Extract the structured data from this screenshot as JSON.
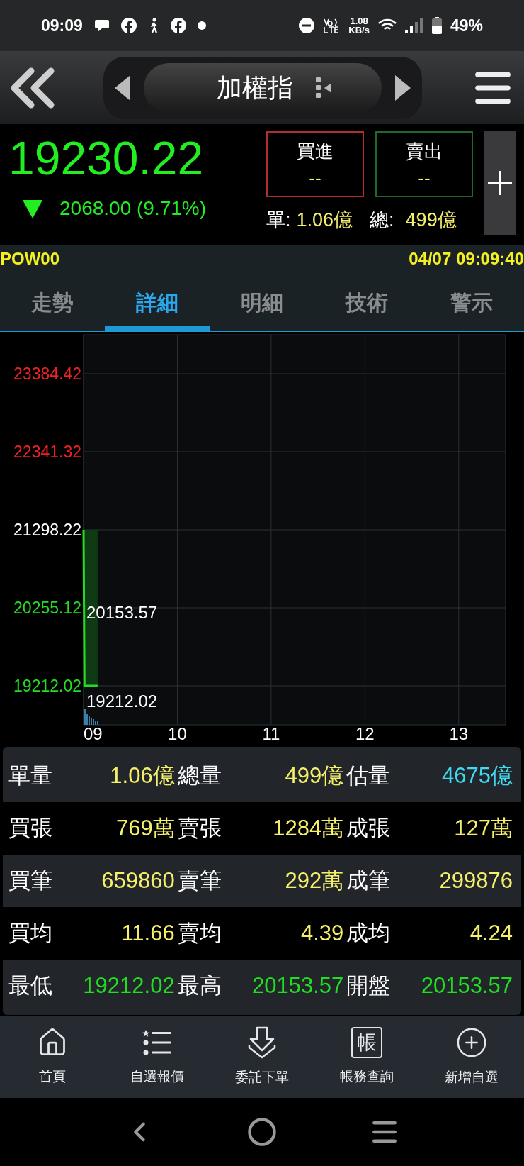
{
  "status_bar": {
    "time": "09:09",
    "speed_value": "1.08",
    "speed_unit": "KB/s",
    "battery": "49%"
  },
  "header": {
    "title": "加權指"
  },
  "quote": {
    "price": "19230.22",
    "change": "2068.00 (9.71%)",
    "buy": {
      "label": "買進",
      "value": "--"
    },
    "sell": {
      "label": "賣出",
      "value": "--"
    },
    "single_label": "單:",
    "single_value": "1.06億",
    "total_label": "總:",
    "total_value": "499億"
  },
  "info_bar": {
    "code": "POW00",
    "datetime": "04/07 09:09:40"
  },
  "tabs": [
    {
      "label": "走勢",
      "selected": false
    },
    {
      "label": "詳細",
      "selected": true
    },
    {
      "label": "明細",
      "selected": false
    },
    {
      "label": "技術",
      "selected": false
    },
    {
      "label": "警示",
      "selected": false
    }
  ],
  "chart_data": {
    "type": "line",
    "grid": true,
    "xlim": [
      9,
      13.5
    ],
    "ylim": [
      18690.47,
      23905.97
    ],
    "xticks": [
      {
        "value": 9,
        "label": "09"
      },
      {
        "value": 10,
        "label": "10"
      },
      {
        "value": 11,
        "label": "11"
      },
      {
        "value": 12,
        "label": "12"
      },
      {
        "value": 13,
        "label": "13"
      }
    ],
    "yticks": [
      {
        "value": 23384.42,
        "label": "23384.42"
      },
      {
        "value": 22341.32,
        "label": "22341.32"
      },
      {
        "value": 21298.22,
        "label": "21298.22"
      },
      {
        "value": 20255.12,
        "label": "20255.12"
      },
      {
        "value": 19212.02,
        "label": "19212.02"
      }
    ],
    "x": [
      9,
      9.01,
      9.15
    ],
    "series": [
      {
        "color": "#22dd22",
        "values": [
          21298.22,
          19212.02,
          19212.02
        ]
      }
    ]
  },
  "chart_labels": [
    {
      "kind": "high",
      "text": "20153.57"
    },
    {
      "kind": "low",
      "text": "19212.02"
    }
  ],
  "stats": [
    [
      {
        "label": "單量",
        "value": "1.06億",
        "color": "#f5f06a"
      },
      {
        "label": "總量",
        "value": "499億",
        "color": "#f5f06a"
      },
      {
        "label": "估量",
        "value": "4675億",
        "color": "#3fd9f0"
      }
    ],
    [
      {
        "label": "買張",
        "value": "769萬",
        "color": "#f5f06a"
      },
      {
        "label": "賣張",
        "value": "1284萬",
        "color": "#f5f06a"
      },
      {
        "label": "成張",
        "value": "127萬",
        "color": "#f5f06a"
      }
    ],
    [
      {
        "label": "買筆",
        "value": "659860",
        "color": "#f5f06a"
      },
      {
        "label": "賣筆",
        "value": "292萬",
        "color": "#f5f06a"
      },
      {
        "label": "成筆",
        "value": "299876",
        "color": "#f5f06a"
      }
    ],
    [
      {
        "label": "買均",
        "value": "11.66",
        "color": "#f5f06a"
      },
      {
        "label": "賣均",
        "value": "4.39",
        "color": "#f5f06a"
      },
      {
        "label": "成均",
        "value": "4.24",
        "color": "#f5f06a"
      }
    ],
    [
      {
        "label": "最低",
        "value": "19212.02",
        "color": "#22dd22"
      },
      {
        "label": "最高",
        "value": "20153.57",
        "color": "#22dd22"
      },
      {
        "label": "開盤",
        "value": "20153.57",
        "color": "#22dd22"
      }
    ]
  ],
  "bottom_nav": [
    {
      "kind": "home",
      "label": "首頁"
    },
    {
      "kind": "watchlist",
      "label": "自選報價"
    },
    {
      "kind": "order",
      "label": "委託下單"
    },
    {
      "kind": "account",
      "label": "帳務查詢",
      "icon_char": "帳"
    },
    {
      "kind": "add",
      "label": "新增自選"
    }
  ]
}
